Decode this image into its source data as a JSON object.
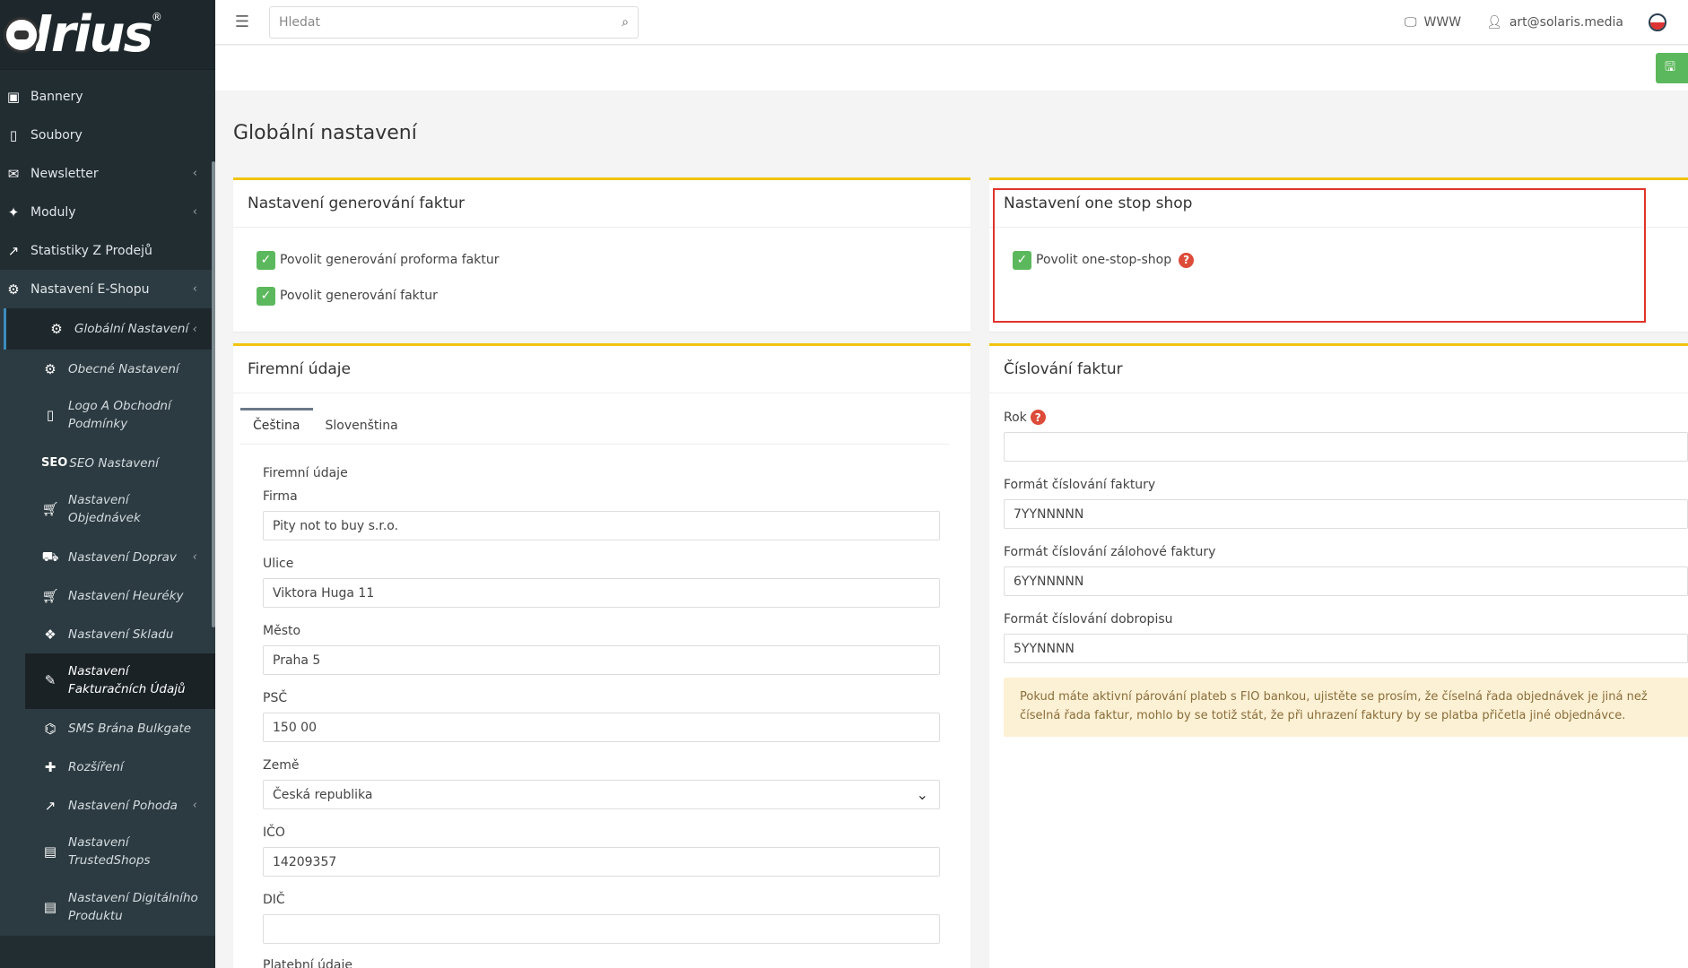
{
  "app": {
    "logo_text": "Irius",
    "logo_mark": "®"
  },
  "sidebar": {
    "items": [
      {
        "label": "Bannery",
        "icon": "image-icon"
      },
      {
        "label": "Soubory",
        "icon": "file-icon"
      },
      {
        "label": "Newsletter",
        "icon": "newsletter-icon"
      },
      {
        "label": "Moduly",
        "icon": "modules-icon"
      },
      {
        "label": "Statistiky Z Prodejů",
        "icon": "chart-icon"
      },
      {
        "label": "Nastavení E-Shopu",
        "icon": "gears-icon"
      }
    ],
    "active_sub": {
      "label": "Globální Nastavení",
      "icon": "gear-icon"
    },
    "sub_items": [
      {
        "label": "Obecné Nastavení",
        "icon": "gear-icon"
      },
      {
        "label": "Logo A Obchodní Podmínky",
        "icon": "file-icon"
      },
      {
        "label": "SEO Nastavení",
        "icon": "seo-icon",
        "prefix": "SEO"
      },
      {
        "label": "Nastavení Objednávek",
        "icon": "cart-icon"
      },
      {
        "label": "Nastavení Doprav",
        "icon": "truck-icon"
      },
      {
        "label": "Nastavení Heuréky",
        "icon": "cart-icon"
      },
      {
        "label": "Nastavení Skladu",
        "icon": "dropbox-icon"
      },
      {
        "label": "Nastavení Fakturačních Údajů",
        "icon": "feather-icon"
      },
      {
        "label": "SMS Brána Bulkgate",
        "icon": "sms-icon"
      },
      {
        "label": "Rozšíření",
        "icon": "puzzle-icon"
      },
      {
        "label": "Nastavení Pohoda",
        "icon": "chart-icon"
      },
      {
        "label": "Nastavení TrustedShops",
        "icon": "card-icon"
      },
      {
        "label": "Nastavení Digitálního Produktu",
        "icon": "card-icon"
      }
    ]
  },
  "header": {
    "search_placeholder": "Hledat",
    "www_label": "WWW",
    "user_email": "art@solaris.media"
  },
  "page_title": "Globální nastavení",
  "invoice_generation": {
    "title": "Nastavení generování faktur",
    "options": [
      {
        "label": "Povolit generování proforma faktur",
        "checked": true
      },
      {
        "label": "Povolit generování faktur",
        "checked": true
      }
    ]
  },
  "one_stop_shop": {
    "title": "Nastavení one stop shop",
    "option": {
      "label": "Povolit one-stop-shop",
      "checked": true
    }
  },
  "company": {
    "title": "Firemní údaje",
    "tabs": [
      "Čeština",
      "Slovenština"
    ],
    "section": "Firemní údaje",
    "fields": [
      {
        "label": "Firma",
        "value": "Pity not to buy s.r.o."
      },
      {
        "label": "Ulice",
        "value": "Viktora Huga 11"
      },
      {
        "label": "Město",
        "value": "Praha 5"
      },
      {
        "label": "PSČ",
        "value": "150 00"
      }
    ],
    "country_label": "Země",
    "country_value": "Česká republika",
    "ico_label": "IČO",
    "ico_value": "14209357",
    "dic_label": "DIČ",
    "dic_value": "",
    "payment_section": "Platební údaje"
  },
  "numbering": {
    "title": "Číslování faktur",
    "year_label": "Rok",
    "year_value": "",
    "fields": [
      {
        "label": "Formát číslování faktury",
        "value": "7YYNNNNN"
      },
      {
        "label": "Formát číslování zálohové faktury",
        "value": "6YYNNNNN"
      },
      {
        "label": "Formát číslování dobropisu",
        "value": "5YYNNNN"
      }
    ],
    "alert": "Pokud máte aktivní párování plateb s FIO bankou, ujistěte se prosím, že číselná řada objednávek je jiná než číselná řada faktur, mohlo by se totiž stát, že při uhrazení faktury by se platba přičetla jiné objednávce."
  }
}
